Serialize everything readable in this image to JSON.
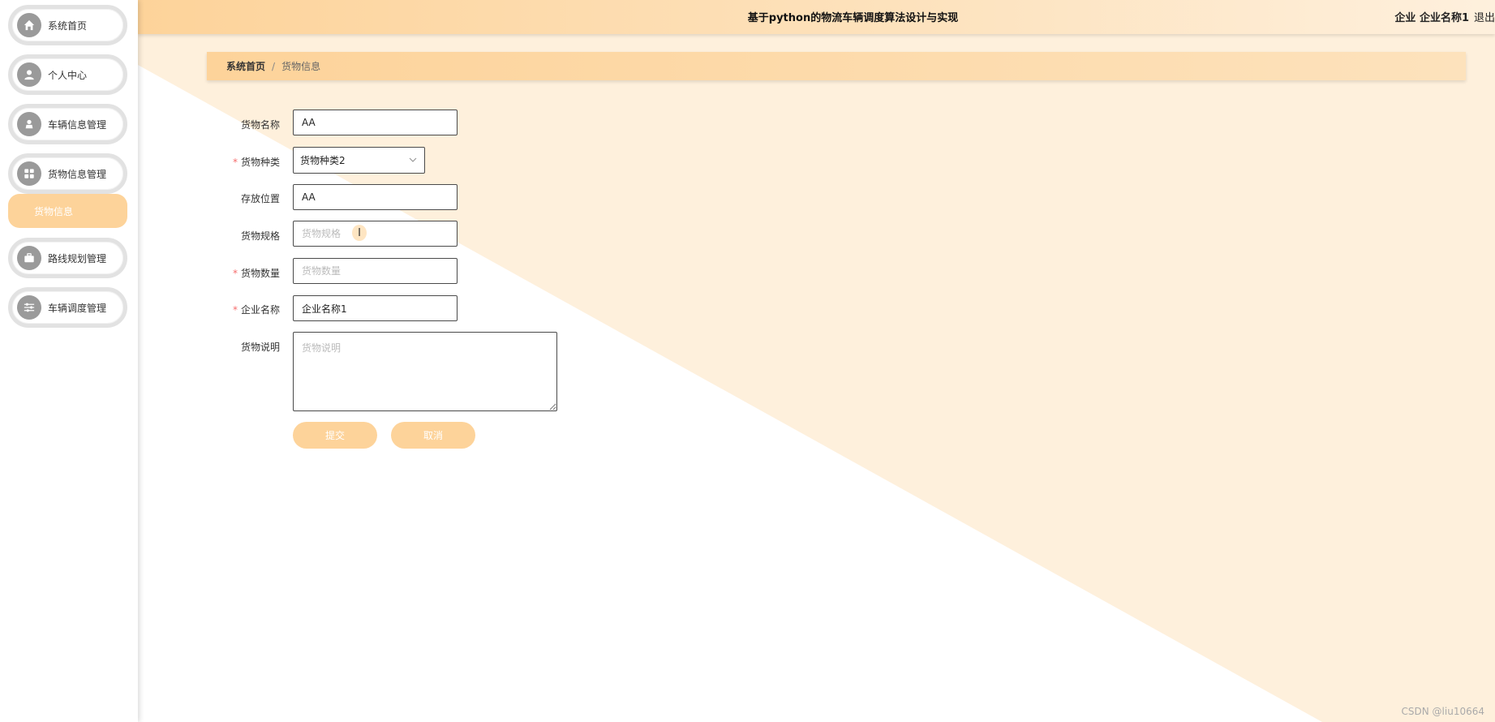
{
  "header": {
    "title": "基于python的物流车辆调度算法设计与实现",
    "user": "企业 企业名称1",
    "logout": "退出"
  },
  "sidebar": {
    "items": [
      {
        "label": "系统首页",
        "icon": "home-icon"
      },
      {
        "label": "个人中心",
        "icon": "user-icon"
      },
      {
        "label": "车辆信息管理",
        "icon": "person-icon"
      },
      {
        "label": "货物信息管理",
        "icon": "grid-icon"
      },
      {
        "label": "路线规划管理",
        "icon": "briefcase-icon"
      },
      {
        "label": "车辆调度管理",
        "icon": "sliders-icon"
      }
    ],
    "submenu": {
      "label": "货物信息"
    }
  },
  "breadcrumb": {
    "home": "系统首页",
    "separator": "/",
    "current": "货物信息"
  },
  "form": {
    "name": {
      "label": "货物名称",
      "value": "AA",
      "required": false
    },
    "category": {
      "label": "货物种类",
      "value": "货物种类2",
      "required": true
    },
    "location": {
      "label": "存放位置",
      "value": "AA",
      "required": false
    },
    "spec": {
      "label": "货物规格",
      "placeholder": "货物规格",
      "required": false
    },
    "quantity": {
      "label": "货物数量",
      "placeholder": "货物数量",
      "required": true
    },
    "company": {
      "label": "企业名称",
      "value": "企业名称1",
      "required": true
    },
    "desc": {
      "label": "货物说明",
      "placeholder": "货物说明",
      "required": false
    },
    "required_mark": "*",
    "submit": "提交",
    "cancel": "取消"
  },
  "colors": {
    "accent": "#fdd39a",
    "background_tint": "#fef0dc"
  },
  "watermark": "CSDN @liu10664"
}
